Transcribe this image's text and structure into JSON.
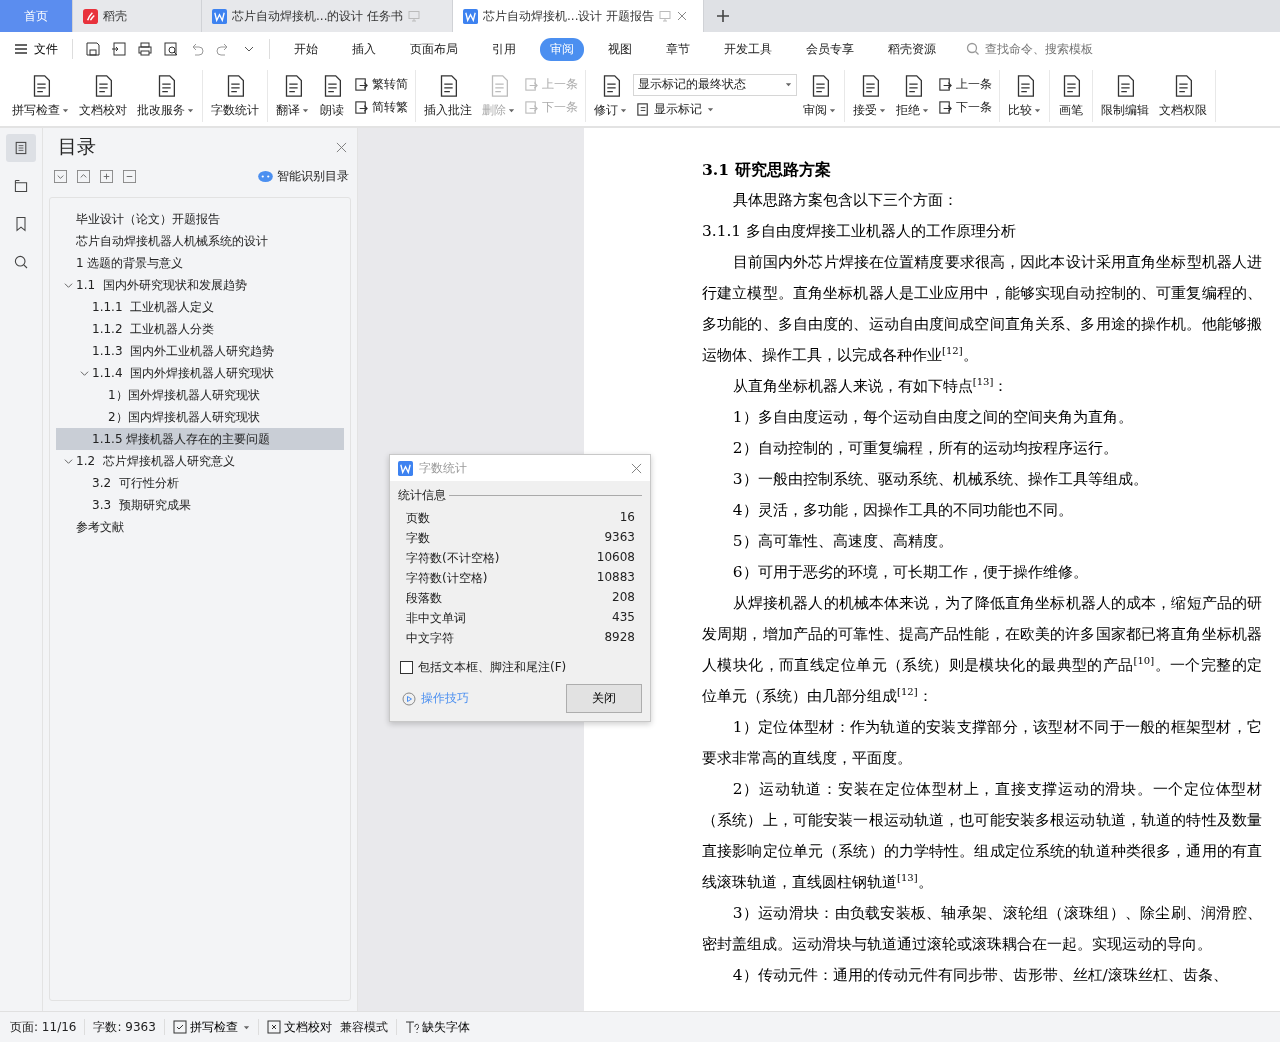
{
  "tabs": [
    {
      "kind": "home",
      "label": "首页",
      "selected": false
    },
    {
      "kind": "app",
      "label": "稻壳",
      "selected": false
    },
    {
      "kind": "doc",
      "label": "芯片自动焊接机...的设计 任务书",
      "selected": false
    },
    {
      "kind": "doc",
      "label": "芯片自动焊接机...设计 开题报告",
      "selected": true
    }
  ],
  "menu": {
    "file": "文件",
    "tabs": [
      {
        "label": "开始",
        "selected": false
      },
      {
        "label": "插入",
        "selected": false
      },
      {
        "label": "页面布局",
        "selected": false
      },
      {
        "label": "引用",
        "selected": false
      },
      {
        "label": "审阅",
        "selected": true
      },
      {
        "label": "视图",
        "selected": false
      },
      {
        "label": "章节",
        "selected": false
      },
      {
        "label": "开发工具",
        "selected": false
      },
      {
        "label": "会员专享",
        "selected": false
      },
      {
        "label": "稻壳资源",
        "selected": false
      }
    ],
    "search": {
      "placeholder": "查找命令、搜索模板"
    }
  },
  "ribbon": {
    "groups": [
      {
        "items": [
          {
            "kind": "big",
            "label": "拼写检查",
            "caret": true,
            "disabled": false
          },
          {
            "kind": "big",
            "label": "文档校对",
            "caret": false,
            "disabled": false
          },
          {
            "kind": "big",
            "label": "批改服务",
            "caret": true,
            "disabled": false
          }
        ]
      },
      {
        "items": [
          {
            "kind": "big",
            "label": "字数统计",
            "caret": false,
            "disabled": false
          }
        ]
      },
      {
        "items": [
          {
            "kind": "big",
            "label": "翻译",
            "caret": true,
            "disabled": false
          },
          {
            "kind": "big",
            "label": "朗读",
            "caret": false,
            "disabled": false
          },
          {
            "kind": "stack",
            "items": [
              {
                "label": "繁转简",
                "disabled": false
              },
              {
                "label": "简转繁",
                "disabled": false
              }
            ]
          }
        ]
      },
      {
        "items": [
          {
            "kind": "big",
            "label": "插入批注",
            "caret": false,
            "disabled": false
          },
          {
            "kind": "big",
            "label": "删除",
            "caret": true,
            "disabled": true
          },
          {
            "kind": "stack",
            "items": [
              {
                "label": "上一条",
                "disabled": true
              },
              {
                "label": "下一条",
                "disabled": true
              }
            ]
          }
        ]
      },
      {
        "items": [
          {
            "kind": "big",
            "label": "修订",
            "caret": true,
            "disabled": false
          },
          {
            "kind": "select",
            "value": "显示标记的最终状态",
            "sub": "显示标记"
          },
          {
            "kind": "big",
            "label": "审阅",
            "caret": true,
            "disabled": false
          }
        ]
      },
      {
        "items": [
          {
            "kind": "big",
            "label": "接受",
            "caret": true,
            "disabled": false
          },
          {
            "kind": "big",
            "label": "拒绝",
            "caret": true,
            "disabled": false
          },
          {
            "kind": "stack",
            "items": [
              {
                "label": "上一条",
                "disabled": false
              },
              {
                "label": "下一条",
                "disabled": false
              }
            ]
          }
        ]
      },
      {
        "items": [
          {
            "kind": "big",
            "label": "比较",
            "caret": true,
            "disabled": false
          }
        ]
      },
      {
        "items": [
          {
            "kind": "big",
            "label": "画笔",
            "caret": false,
            "disabled": false
          }
        ]
      },
      {
        "items": [
          {
            "kind": "big",
            "label": "限制编辑",
            "caret": false,
            "disabled": false
          },
          {
            "kind": "big",
            "label": "文档权限",
            "caret": false,
            "disabled": false
          }
        ]
      }
    ]
  },
  "nav": {
    "title": "目录",
    "smart": "智能识别目录",
    "items": [
      {
        "label": "毕业设计（论文）开题报告",
        "selected": false
      },
      {
        "label": "芯片自动焊接机器人机械系统的设计",
        "selected": false
      },
      {
        "label": "1 选题的背景与意义",
        "selected": false
      },
      {
        "label": "1.1  国内外研究现状和发展趋势",
        "selected": false,
        "expanded": true,
        "children": [
          {
            "label": "1.1.1  工业机器人定义",
            "selected": false
          },
          {
            "label": "1.1.2  工业机器人分类",
            "selected": false
          },
          {
            "label": "1.1.3  国内外工业机器人研究趋势",
            "selected": false
          },
          {
            "label": "1.1.4  国内外焊接机器人研究现状",
            "selected": false,
            "expanded": true,
            "children": [
              {
                "label": "1）国外焊接机器人研究现状",
                "selected": false
              },
              {
                "label": "2）国内焊接机器人研究现状",
                "selected": false
              }
            ]
          },
          {
            "label": "1.1.5 焊接机器人存在的主要问题",
            "selected": true
          }
        ]
      },
      {
        "label": "1.2  芯片焊接机器人研究意义",
        "selected": false,
        "expanded": true,
        "children": [
          {
            "label": "3.2  可行性分析",
            "selected": false
          },
          {
            "label": "3.3  预期研究成果",
            "selected": false
          }
        ]
      },
      {
        "label": "参考文献",
        "selected": false
      }
    ]
  },
  "dialog": {
    "title": "字数统计",
    "section": "统计信息",
    "rows": [
      {
        "label": "页数",
        "value": "16"
      },
      {
        "label": "字数",
        "value": "9363"
      },
      {
        "label": "字符数(不计空格)",
        "value": "10608"
      },
      {
        "label": "字符数(计空格)",
        "value": "10883"
      },
      {
        "label": "段落数",
        "value": "208"
      },
      {
        "label": "非中文单词",
        "value": "435"
      },
      {
        "label": "中文字符",
        "value": "8928"
      }
    ],
    "checkbox": {
      "label": "包括文本框、脚注和尾注(F)",
      "checked": false
    },
    "link": "操作技巧",
    "button": "关闭"
  },
  "document": {
    "paragraphs": [
      {
        "kind": "heading",
        "text": "3.1 研究思路方案"
      },
      {
        "kind": "body",
        "text": "具体思路方案包含以下三个方面："
      },
      {
        "kind": "subheading",
        "text": "3.1.1  多自由度焊接工业机器人的工作原理分析"
      },
      {
        "kind": "body",
        "text": "目前国内外芯片焊接在位置精度要求很高，因此本设计采用直角坐标型机器人进行建立模型。直角坐标机器人是工业应用中，能够实现自动控制的、可重复编程的、多功能的、多自由度的、运动自由度间成空间直角关系、多用途的操作机。他能够搬运物体、操作工具，以完成各种作业$^{[12]}$。"
      },
      {
        "kind": "body",
        "text": "从直角坐标机器人来说，有如下特点$^{[13]}$："
      },
      {
        "kind": "body",
        "text": "1）多自由度运动，每个运动自由度之间的空间夹角为直角。"
      },
      {
        "kind": "body",
        "text": "2）自动控制的，可重复编程，所有的运动均按程序运行。"
      },
      {
        "kind": "body",
        "text": "3）一般由控制系统、驱动系统、机械系统、操作工具等组成。"
      },
      {
        "kind": "body",
        "text": "4）灵活，多功能，因操作工具的不同功能也不同。"
      },
      {
        "kind": "body",
        "text": "5）高可靠性、高速度、高精度。"
      },
      {
        "kind": "body",
        "text": "6）可用于恶劣的环境，可长期工作，便于操作维修。"
      },
      {
        "kind": "body",
        "text": "从焊接机器人的机械本体来说，为了降低直角坐标机器人的成本，缩短产品的研发周期，增加产品的可靠性、提高产品性能，在欧美的许多国家都已将直角坐标机器人模块化，而直线定位单元（系统）则是模块化的最典型的产品$^{[10]}$。一个完整的定位单元（系统）由几部分组成$^{[12]}$："
      },
      {
        "kind": "body",
        "text": "1）定位体型材：作为轨道的安装支撑部分，该型材不同于一般的框架型材，它要求非常高的直线度，平面度。"
      },
      {
        "kind": "body",
        "text": "2）运动轨道：安装在定位体型材上，直接支撑运动的滑块。一个定位体型材（系统）上，可能安装一根运动轨道，也可能安装多根运动轨道，轨道的特性及数量直接影响定位单元（系统）的力学特性。组成定位系统的轨道种类很多，通用的有直线滚珠轨道，直线圆柱钢轨道$^{[13]}$。"
      },
      {
        "kind": "body",
        "text": "3）运动滑块：由负载安装板、轴承架、滚轮组（滚珠组）、除尘刷、润滑腔、密封盖组成。运动滑块与轨道通过滚轮或滚珠耦合在一起。实现运动的导向。"
      },
      {
        "kind": "body",
        "text": "4）传动元件：通用的传动元件有同步带、齿形带、丝杠/滚珠丝杠、齿条、"
      }
    ]
  },
  "status": {
    "page": "页面: 11/16",
    "words": "字数: 9363",
    "spell": "拼写检查",
    "proof": "文档校对",
    "compat": "兼容模式",
    "font": "缺失字体"
  }
}
